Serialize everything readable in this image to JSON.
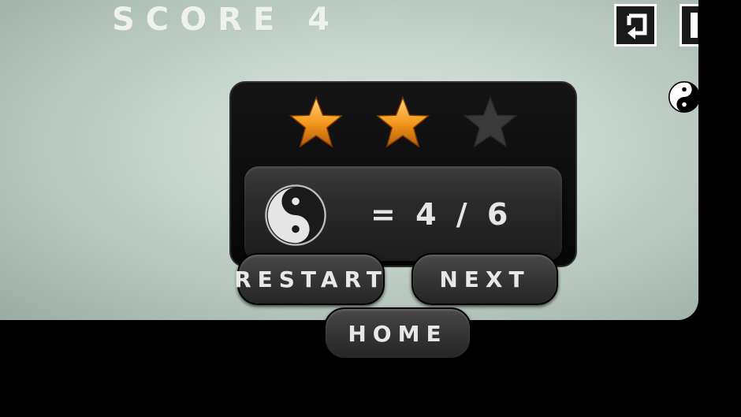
{
  "hud": {
    "score_label": "SCORE",
    "score_value": "4",
    "restart_icon": "restart-icon",
    "pause_icon": "pause-icon"
  },
  "dialog": {
    "stars_total": 3,
    "stars_earned": 2,
    "ratio_text": "= 4 / 6",
    "icon": "yin-yang-icon"
  },
  "buttons": {
    "restart": "RESTART",
    "next": "NEXT",
    "home": "HOME"
  },
  "colors": {
    "star_active": "#f59a1e",
    "star_inactive": "#3a3a3a",
    "background": "#c7d6cd"
  }
}
